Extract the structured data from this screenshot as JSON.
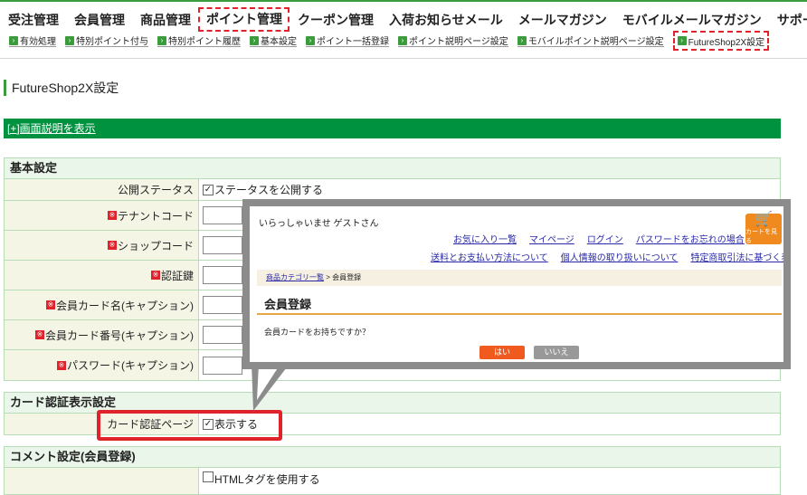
{
  "top_nav": {
    "items": [
      {
        "label": "受注管理"
      },
      {
        "label": "会員管理"
      },
      {
        "label": "商品管理"
      },
      {
        "label": "ポイント管理"
      },
      {
        "label": "クーポン管理"
      },
      {
        "label": "入荷お知らせメール"
      },
      {
        "label": "メールマガジン"
      },
      {
        "label": "モバイルメールマガジン"
      },
      {
        "label": "サポート"
      }
    ]
  },
  "sub_nav": {
    "items": [
      {
        "label": "有効処理"
      },
      {
        "label": "特別ポイント付与"
      },
      {
        "label": "特別ポイント履歴"
      },
      {
        "label": "基本設定"
      },
      {
        "label": "ポイント一括登録"
      },
      {
        "label": "ポイント説明ページ設定"
      },
      {
        "label": "モバイルポイント説明ページ設定"
      },
      {
        "label": "FutureShop2X設定"
      }
    ]
  },
  "page": {
    "title": "FutureShop2X設定",
    "show_description": "[+]画面説明を表示"
  },
  "basic": {
    "heading": "基本設定",
    "rows": [
      {
        "label": "公開ステータス",
        "checkbox_label": "ステータスを公開する"
      },
      {
        "label": "テナントコード"
      },
      {
        "label": "ショップコード"
      },
      {
        "label": "認証鍵"
      },
      {
        "label": "会員カード名(キャプション)"
      },
      {
        "label": "会員カード番号(キャプション)"
      },
      {
        "label": "パスワード(キャプション)"
      }
    ]
  },
  "card_auth": {
    "heading": "カード認証表示設定",
    "label": "カード認証ページ",
    "checkbox_label": "表示する"
  },
  "comment": {
    "heading": "コメント設定(会員登録)",
    "checkbox_label": "HTMLタグを使用する"
  },
  "popup": {
    "welcome": "いらっしゃいませ ゲストさん",
    "links_row1": [
      "お気に入り一覧",
      "マイページ",
      "ログイン",
      "パスワードをお忘れの場合"
    ],
    "links_row2": [
      "送料とお支払い方法について",
      "個人情報の取り扱いについて",
      "特定商取引法に基づく表示"
    ],
    "cart_label": "カートを見る",
    "breadcrumb_link": "商品カテゴリ一覧",
    "breadcrumb_sep": " > ",
    "breadcrumb_current": "会員登録",
    "heading": "会員登録",
    "question": "会員カードをお持ちですか？",
    "yes": "はい",
    "no": "いいえ"
  },
  "colors": {
    "accent_green": "#00923f",
    "highlight_red": "#e0222a",
    "popup_orange": "#f05a1e"
  }
}
